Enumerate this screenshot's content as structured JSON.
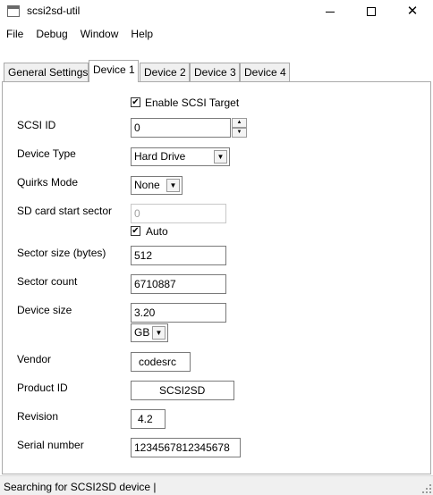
{
  "window": {
    "title": "scsi2sd-util",
    "minimize_glyph": "",
    "maximize_glyph": "",
    "close_glyph": "✕"
  },
  "menu": [
    "File",
    "Debug",
    "Window",
    "Help"
  ],
  "tabs": [
    "General Settings",
    "Device 1",
    "Device 2",
    "Device 3",
    "Device 4"
  ],
  "form": {
    "enable_label": "Enable SCSI Target",
    "enable_checked": true,
    "scsi_id": {
      "label": "SCSI ID",
      "value": "0"
    },
    "device_type": {
      "label": "Device Type",
      "value": "Hard Drive"
    },
    "quirks": {
      "label": "Quirks Mode",
      "value": "None"
    },
    "sd_start": {
      "label": "SD card start sector",
      "value": "0"
    },
    "auto_label": "Auto",
    "auto_checked": true,
    "sector_size": {
      "label": "Sector size (bytes)",
      "value": "512"
    },
    "sector_count": {
      "label": "Sector count",
      "value": "6710887"
    },
    "device_size": {
      "label": "Device size",
      "value": "3.20",
      "unit": "GB"
    },
    "vendor": {
      "label": "Vendor",
      "value": "codesrc"
    },
    "product_id": {
      "label": "Product ID",
      "value": "SCSI2SD"
    },
    "revision": {
      "label": "Revision",
      "value": "4.2"
    },
    "serial": {
      "label": "Serial number",
      "value": "1234567812345678"
    }
  },
  "glyphs": {
    "check": "✔",
    "dropdown": "▼",
    "spin_up": "▲",
    "spin_down": "▼"
  },
  "status": "Searching for SCSI2SD device |"
}
